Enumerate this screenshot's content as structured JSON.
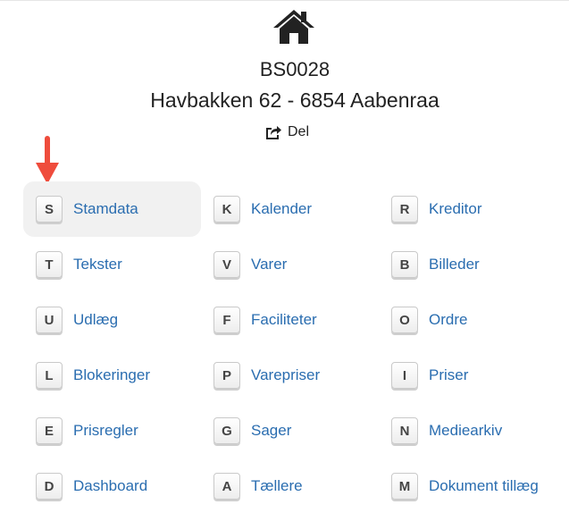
{
  "header": {
    "code": "BS0028",
    "address": "Havbakken 62 - 6854 Aabenraa",
    "share_label": "Del"
  },
  "colors": {
    "link": "#2a6db0",
    "arrow": "#ef4c3c",
    "active_bg": "#f1f1f1"
  },
  "menu": [
    {
      "key": "S",
      "label": "Stamdata",
      "active": true
    },
    {
      "key": "K",
      "label": "Kalender"
    },
    {
      "key": "R",
      "label": "Kreditor"
    },
    {
      "key": "T",
      "label": "Tekster"
    },
    {
      "key": "V",
      "label": "Varer"
    },
    {
      "key": "B",
      "label": "Billeder"
    },
    {
      "key": "U",
      "label": "Udlæg"
    },
    {
      "key": "F",
      "label": "Faciliteter"
    },
    {
      "key": "O",
      "label": "Ordre"
    },
    {
      "key": "L",
      "label": "Blokeringer"
    },
    {
      "key": "P",
      "label": "Varepriser"
    },
    {
      "key": "I",
      "label": "Priser"
    },
    {
      "key": "E",
      "label": "Prisregler"
    },
    {
      "key": "G",
      "label": "Sager"
    },
    {
      "key": "N",
      "label": "Mediearkiv"
    },
    {
      "key": "D",
      "label": "Dashboard"
    },
    {
      "key": "A",
      "label": "Tællere"
    },
    {
      "key": "M",
      "label": "Dokument tillæg"
    }
  ]
}
